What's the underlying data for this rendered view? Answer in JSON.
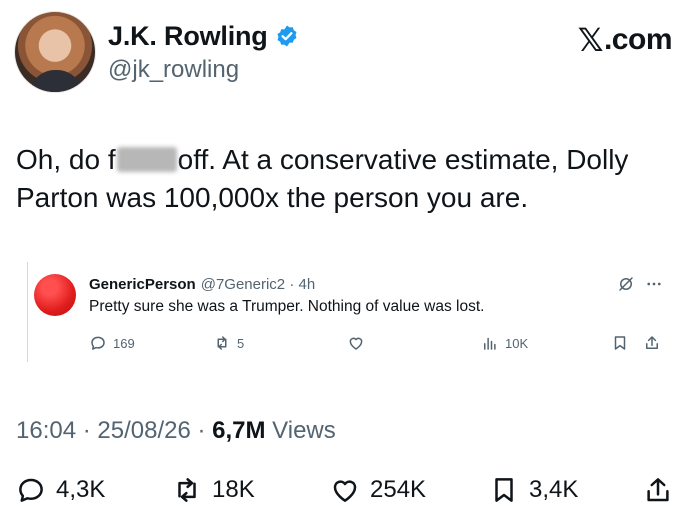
{
  "header": {
    "name": "J.K. Rowling",
    "handle": "@jk_rowling",
    "verified": true,
    "brand": "X.com",
    "verified_color": "#1d9bf0"
  },
  "tweet": {
    "text_part1": "Oh, do f",
    "text_part2": "off. At a conservative estimate, Dolly Parton was 100,000x the person you are."
  },
  "quoted_reply": {
    "name": "GenericPerson",
    "meta": "@7Generic2 · 4h",
    "text": "Pretty sure she was a Trumper. Nothing of value was lost.",
    "replies": "169",
    "reposts": "5",
    "views": "10K",
    "avatar_color": "#e11d1d"
  },
  "meta": {
    "timestamp": "16:04 · 25/08/26 · ",
    "views_count": "6,7M",
    "views_label": " Views"
  },
  "actions": {
    "replies": "4,3K",
    "reposts": "18K",
    "likes": "254K",
    "bookmarks": "3,4K"
  }
}
